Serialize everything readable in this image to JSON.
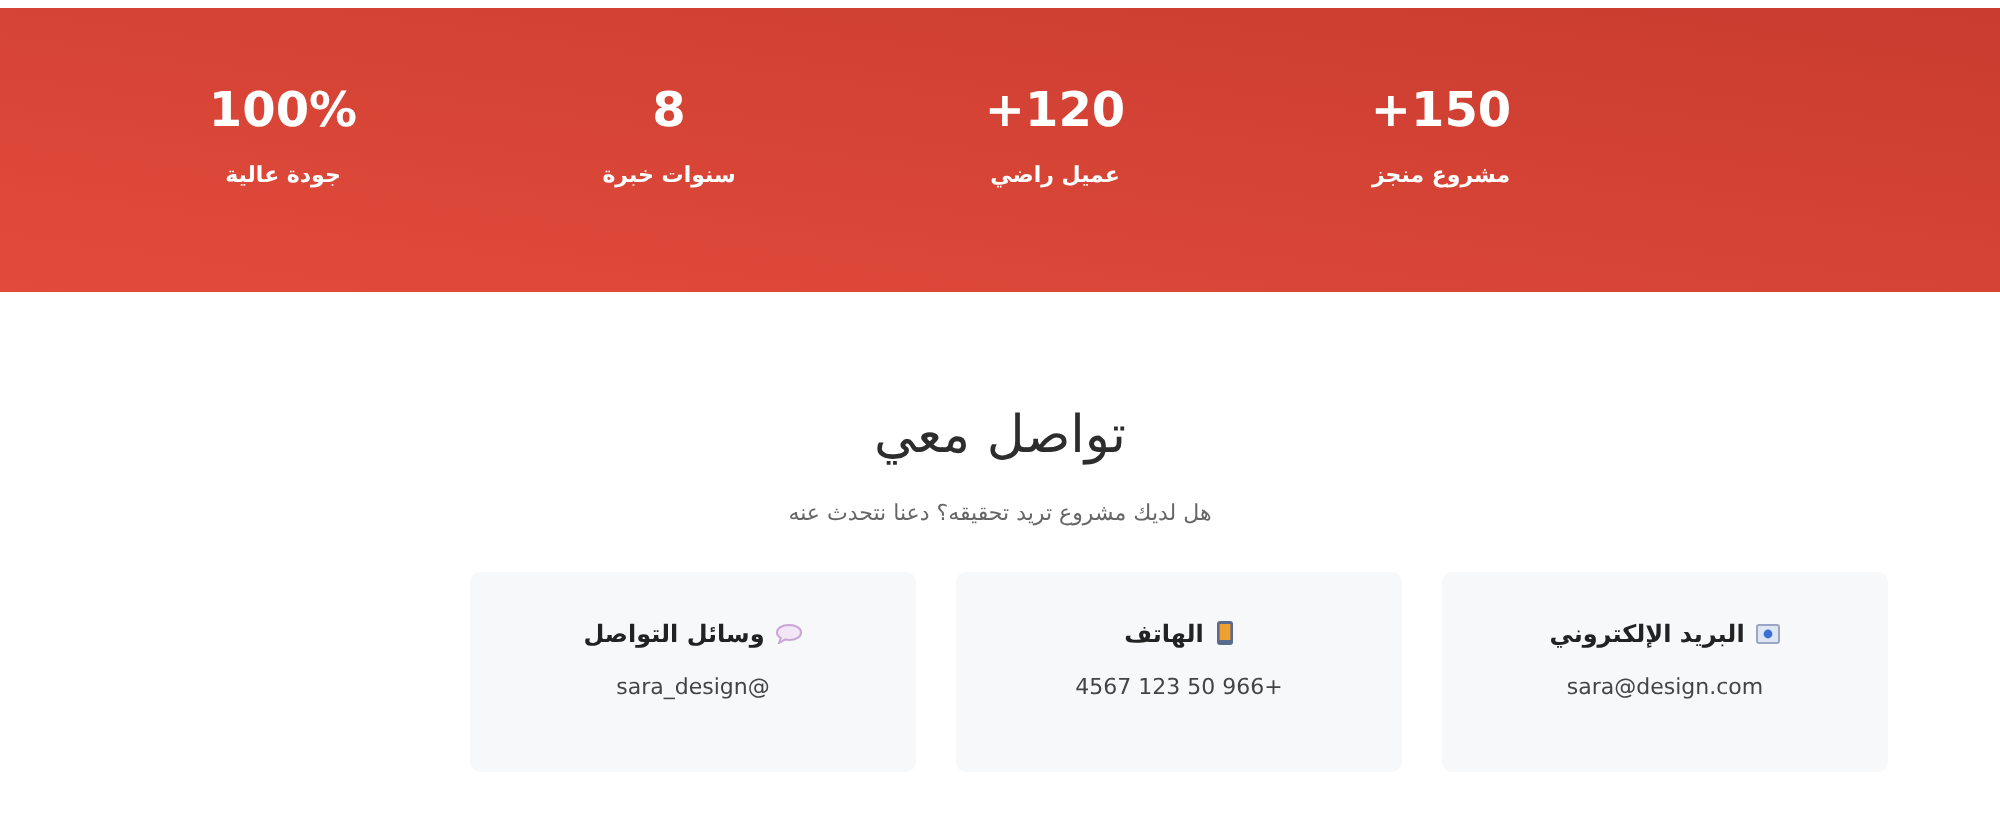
{
  "stats": [
    {
      "value": "150+",
      "label": "مشروع منجز"
    },
    {
      "value": "120+",
      "label": "عميل راضي"
    },
    {
      "value": "8",
      "label": "سنوات خبرة"
    },
    {
      "value": "100%",
      "label": "جودة عالية"
    }
  ],
  "contact": {
    "title": "تواصل معي",
    "subtitle": "هل لديك مشروع تريد تحقيقه؟ دعنا نتحدث عنه",
    "cards": [
      {
        "kind": "email",
        "title": "البريد الإلكتروني",
        "value": "sara@design.com"
      },
      {
        "kind": "phone",
        "title": "الهاتف",
        "value": "+966 50 123 4567"
      },
      {
        "kind": "social",
        "title": "وسائل التواصل",
        "value": "@sara_design"
      }
    ]
  }
}
